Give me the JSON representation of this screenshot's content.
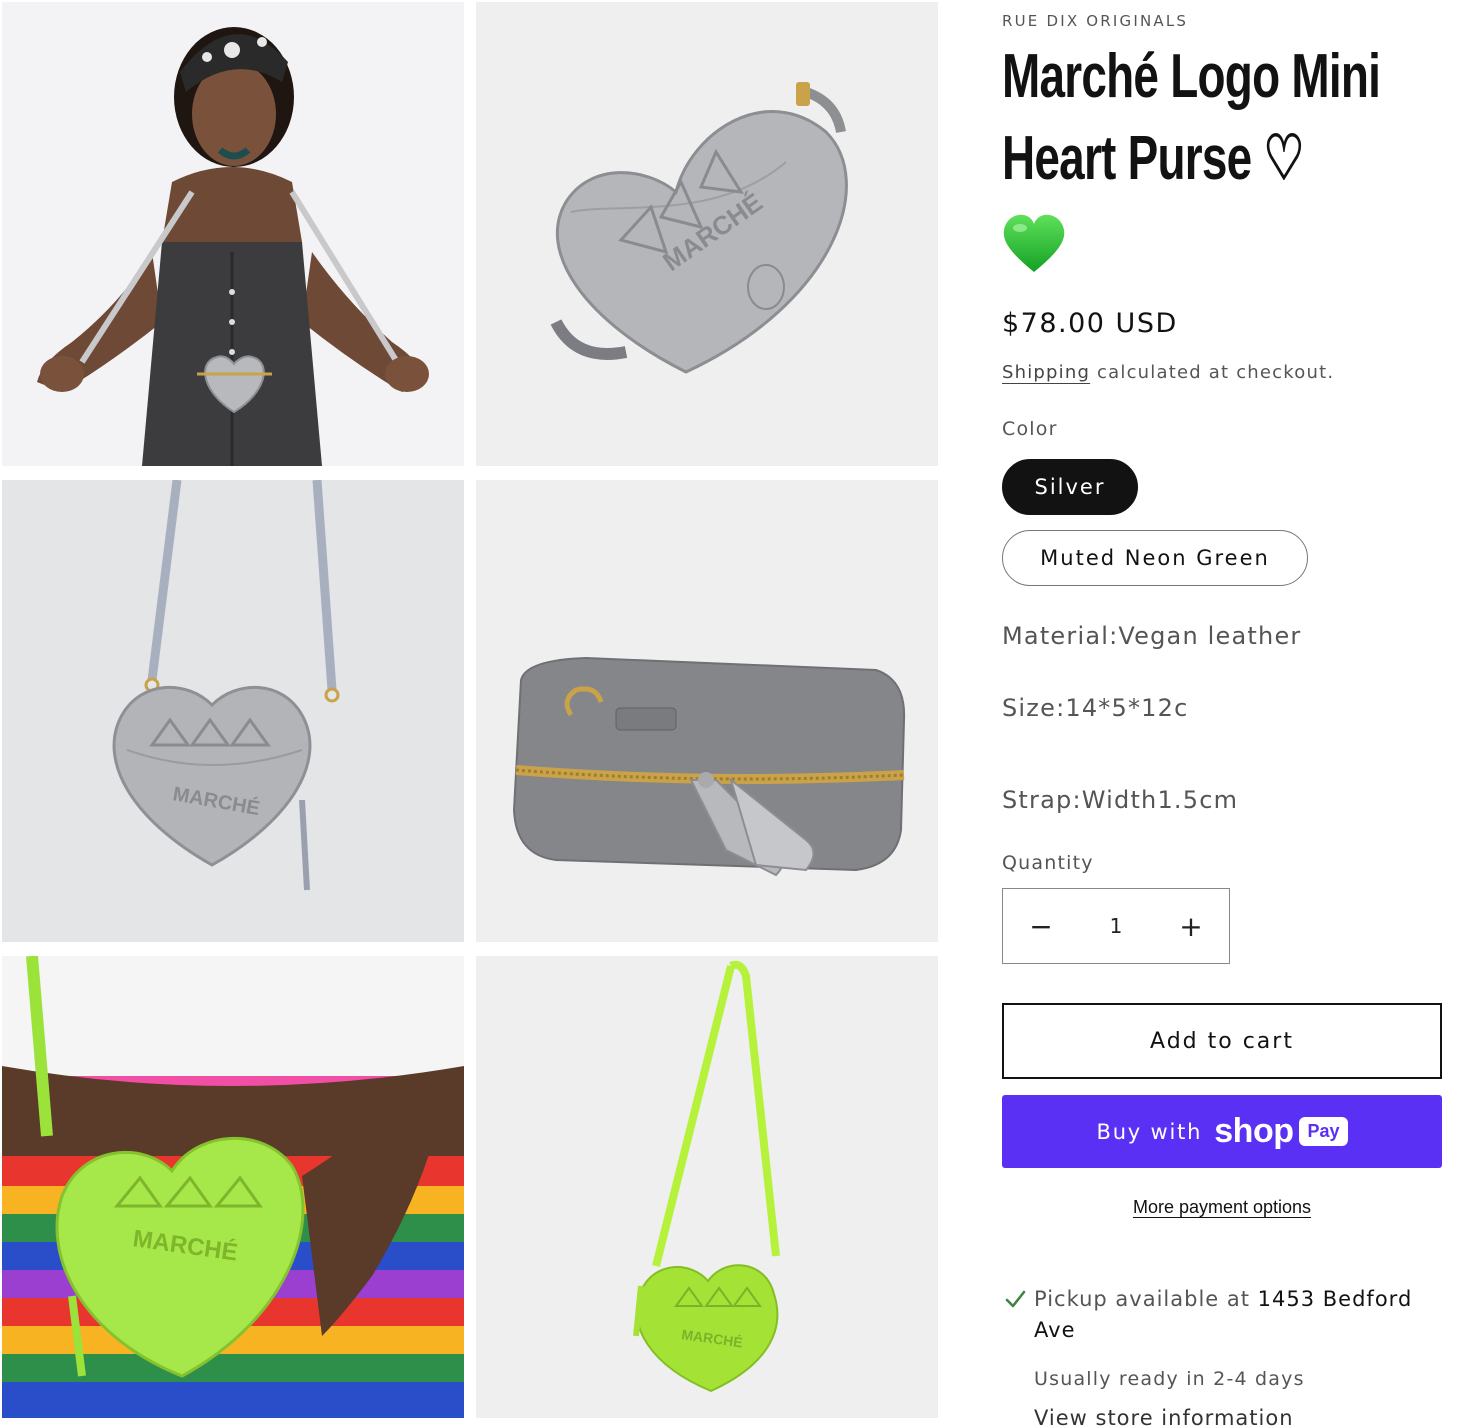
{
  "gallery": {
    "images": [
      {
        "name": "model-wearing-silver-purse"
      },
      {
        "name": "silver-heart-purse-front"
      },
      {
        "name": "silver-heart-purse-hanging"
      },
      {
        "name": "silver-heart-purse-zipper"
      },
      {
        "name": "green-heart-purse-on-model"
      },
      {
        "name": "green-heart-purse-hanging"
      }
    ],
    "embossed_text": "MARCHÉ"
  },
  "product": {
    "vendor": "RUE DIX ORIGINALS",
    "title_line1": "Marché Logo Mini",
    "title_line2": "Heart Purse ♡",
    "price": "$78.00 USD",
    "shipping_link": "Shipping",
    "shipping_suffix": " calculated at checkout.",
    "color_label": "Color",
    "colors": [
      {
        "label": "Silver",
        "selected": true
      },
      {
        "label": "Muted Neon Green",
        "selected": false
      }
    ],
    "material": "Material:Vegan leather",
    "size": "Size:14*5*12c",
    "strap": "Strap:Width1.5cm",
    "quantity_label": "Quantity",
    "quantity_value": "1",
    "decrease_symbol": "−",
    "increase_symbol": "+",
    "add_to_cart": "Add to cart",
    "buy_with": "Buy with",
    "shop_word": "shop",
    "pay_word": "Pay",
    "more_payment": "More payment options",
    "pickup_prefix": "Pickup available at ",
    "pickup_location": "1453 Bedford Ave",
    "pickup_ready": "Usually ready in 2-4 days",
    "store_info": "View store information"
  },
  "colors": {
    "accent_shop_pay": "#5a31f4",
    "selected_pill": "#121212",
    "check": "#428445"
  }
}
